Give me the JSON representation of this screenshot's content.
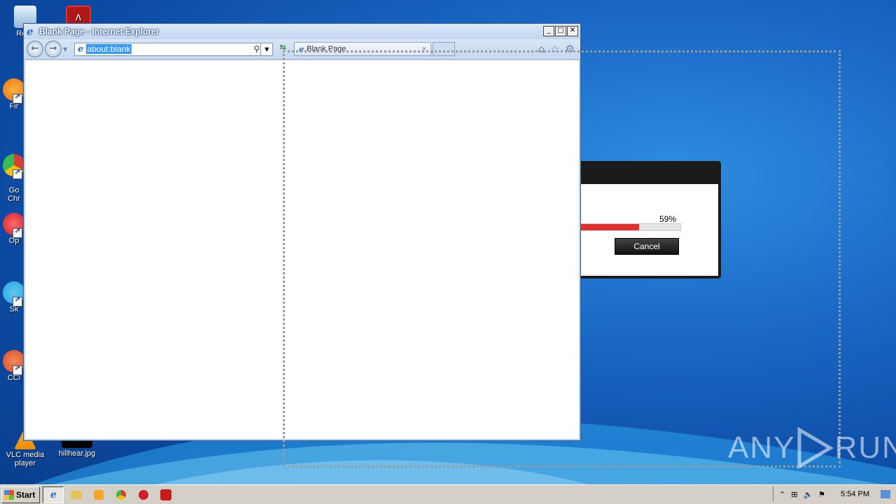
{
  "desktop": {
    "icons": [
      {
        "label": "Recy",
        "color": "#6aa7e0"
      },
      {
        "label": "",
        "color": "#b01818"
      },
      {
        "label": "Fir",
        "color": "#e8741c"
      },
      {
        "label": "Go\nChr",
        "color": "#d94032"
      },
      {
        "label": "Op",
        "color": "#cc1f2b"
      },
      {
        "label": "Sk",
        "color": "#2aa5e0"
      },
      {
        "label": "CCl",
        "color": "#d74a2a"
      },
      {
        "label": "VLC media player",
        "color": "#f08a00"
      },
      {
        "label": "hillhear.jpg",
        "color": "#000000"
      }
    ]
  },
  "ie_window": {
    "title": "Blank Page - Internet Explorer",
    "address": "about:blank",
    "tab_title": "Blank Page",
    "caption_min": "_",
    "caption_max": "□",
    "caption_close": "✕"
  },
  "progress_dialog": {
    "percent_text": "59%",
    "progress": 0.59,
    "cancel_label": "Cancel",
    "accent": "#e03030"
  },
  "watermark": {
    "text": "ANY",
    "text2": "RUN"
  },
  "taskbar": {
    "start_label": "Start",
    "apps": [
      "ie-icon",
      "explorer-icon",
      "media-player-icon",
      "chrome-icon",
      "opera-icon",
      "app-icon"
    ],
    "clock": "5:54 PM"
  }
}
